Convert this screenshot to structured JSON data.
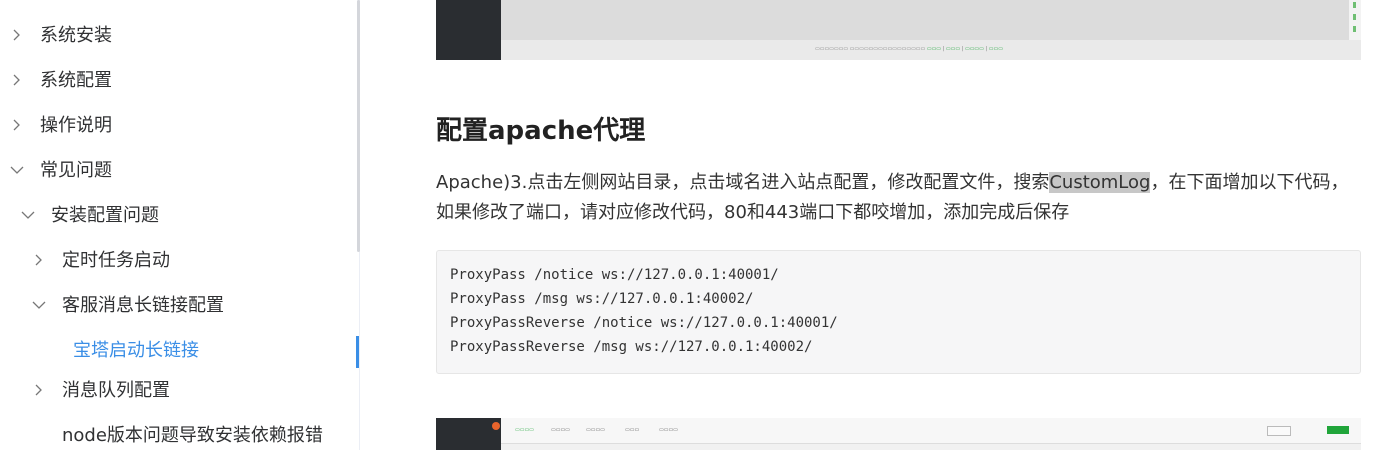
{
  "sidebar": {
    "items": [
      {
        "label": "系统安装"
      },
      {
        "label": "系统配置"
      },
      {
        "label": "操作说明"
      },
      {
        "label": "常见问题"
      },
      {
        "label": "安装配置问题"
      },
      {
        "label": "定时任务启动"
      },
      {
        "label": "客服消息长链接配置"
      },
      {
        "label": "宝塔启动长链接"
      },
      {
        "label": "消息队列配置"
      },
      {
        "label": "node版本问题导致安装依赖报错"
      }
    ]
  },
  "article": {
    "title": "配置apache代理",
    "para_before": "Apache)3.点击左侧网站目录，点击域名进入站点配置，修改配置文件，搜索",
    "para_highlight": "CustomLog",
    "para_after": "，在下面增加以下代码，如果修改了端口，请对应修改代码，80和443端口下都咬增加，添加完成后保存",
    "code": [
      "ProxyPass /notice ws://127.0.0.1:40001/",
      "ProxyPass /msg ws://127.0.0.1:40002/",
      "ProxyPassReverse /notice ws://127.0.0.1:40001/",
      "ProxyPassReverse /msg ws://127.0.0.1:40002/"
    ]
  },
  "colors": {
    "accent": "#3a8ee6",
    "bt_green": "#20a53a"
  }
}
